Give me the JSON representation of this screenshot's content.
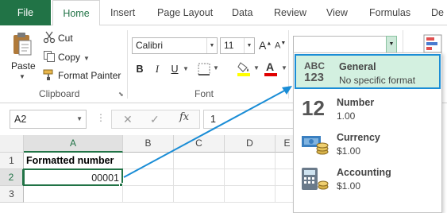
{
  "tabs": [
    "File",
    "Home",
    "Insert",
    "Page Layout",
    "Data",
    "Review",
    "View",
    "Formulas",
    "De"
  ],
  "clipboard": {
    "paste_label": "Paste",
    "cut_label": "Cut",
    "copy_label": "Copy",
    "format_painter_label": "Format Painter",
    "group_label": "Clipboard"
  },
  "font": {
    "name": "Calibri",
    "size": "11",
    "grow": "A",
    "shrink": "A",
    "bold": "B",
    "italic": "I",
    "underline": "U",
    "color_letter": "A",
    "group_label": "Font"
  },
  "number_format_box": {
    "value": ""
  },
  "formula_bar": {
    "name_box": "A2",
    "cancel": "✕",
    "enter": "✓",
    "fx": "fx",
    "value": "1"
  },
  "grid": {
    "columns": [
      "A",
      "B",
      "C",
      "D",
      "E"
    ],
    "rows": [
      "1",
      "2",
      "3"
    ],
    "cells": {
      "A1": "Formatted number",
      "A2": "00001"
    }
  },
  "number_formats": [
    {
      "icon": "general-icon",
      "icon_top": "ABC",
      "icon_bottom": "123",
      "name": "General",
      "sample": "No specific format"
    },
    {
      "icon": "number-icon",
      "icon_top": "12",
      "name": "Number",
      "sample": "1.00"
    },
    {
      "icon": "currency-icon",
      "name": "Currency",
      "sample": "$1.00"
    },
    {
      "icon": "accounting-icon",
      "name": "Accounting",
      "sample": " $1.00"
    }
  ],
  "colors": {
    "excel_green": "#217346",
    "highlight_fill": "#d3f0e0",
    "highlight_border": "#1a8dd6",
    "arrow": "#1a8dd6",
    "font_color_bar": "#e00000",
    "fill_color_bar": "#ffff00"
  }
}
